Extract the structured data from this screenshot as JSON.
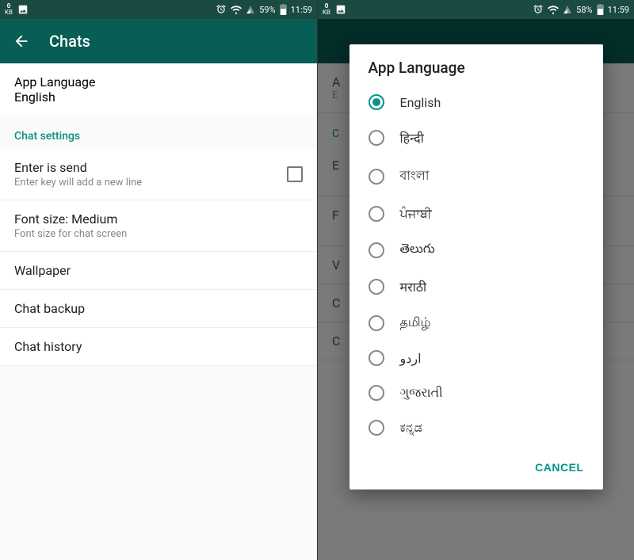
{
  "screen1": {
    "status": {
      "kb": "0",
      "kb_unit": "KB",
      "battery": "59%",
      "time": "11:59"
    },
    "appbar": {
      "title": "Chats"
    },
    "appLanguage": {
      "label": "App Language",
      "value": "English"
    },
    "sectionHeader": "Chat settings",
    "items": [
      {
        "primary": "Enter is send",
        "secondary": "Enter key will add a new line",
        "check": true
      },
      {
        "primary": "Font size: Medium",
        "secondary": "Font size for chat screen"
      },
      {
        "primary": "Wallpaper"
      },
      {
        "primary": "Chat backup"
      },
      {
        "primary": "Chat history"
      }
    ]
  },
  "screen2": {
    "status": {
      "kb": "0",
      "kb_unit": "KB",
      "battery": "58%",
      "time": "11:59"
    },
    "dialog": {
      "title": "App Language",
      "options": [
        {
          "label": "English",
          "selected": true
        },
        {
          "label": "हिन्दी",
          "selected": false
        },
        {
          "label": "বাংলা",
          "selected": false
        },
        {
          "label": "ਪੰਜਾਬੀ",
          "selected": false
        },
        {
          "label": "తెలుగు",
          "selected": false
        },
        {
          "label": "मराठी",
          "selected": false
        },
        {
          "label": "தமிழ்",
          "selected": false
        },
        {
          "label": "اردو",
          "selected": false
        },
        {
          "label": "ગુજરાતી",
          "selected": false
        },
        {
          "label": "ಕನ್ನಡ",
          "selected": false
        }
      ],
      "cancel": "CANCEL"
    },
    "bg": {
      "appLanguage": {
        "label": "A",
        "value": "E"
      },
      "section": "C",
      "rows": [
        "E",
        "F",
        "V",
        "C",
        "C"
      ]
    }
  }
}
